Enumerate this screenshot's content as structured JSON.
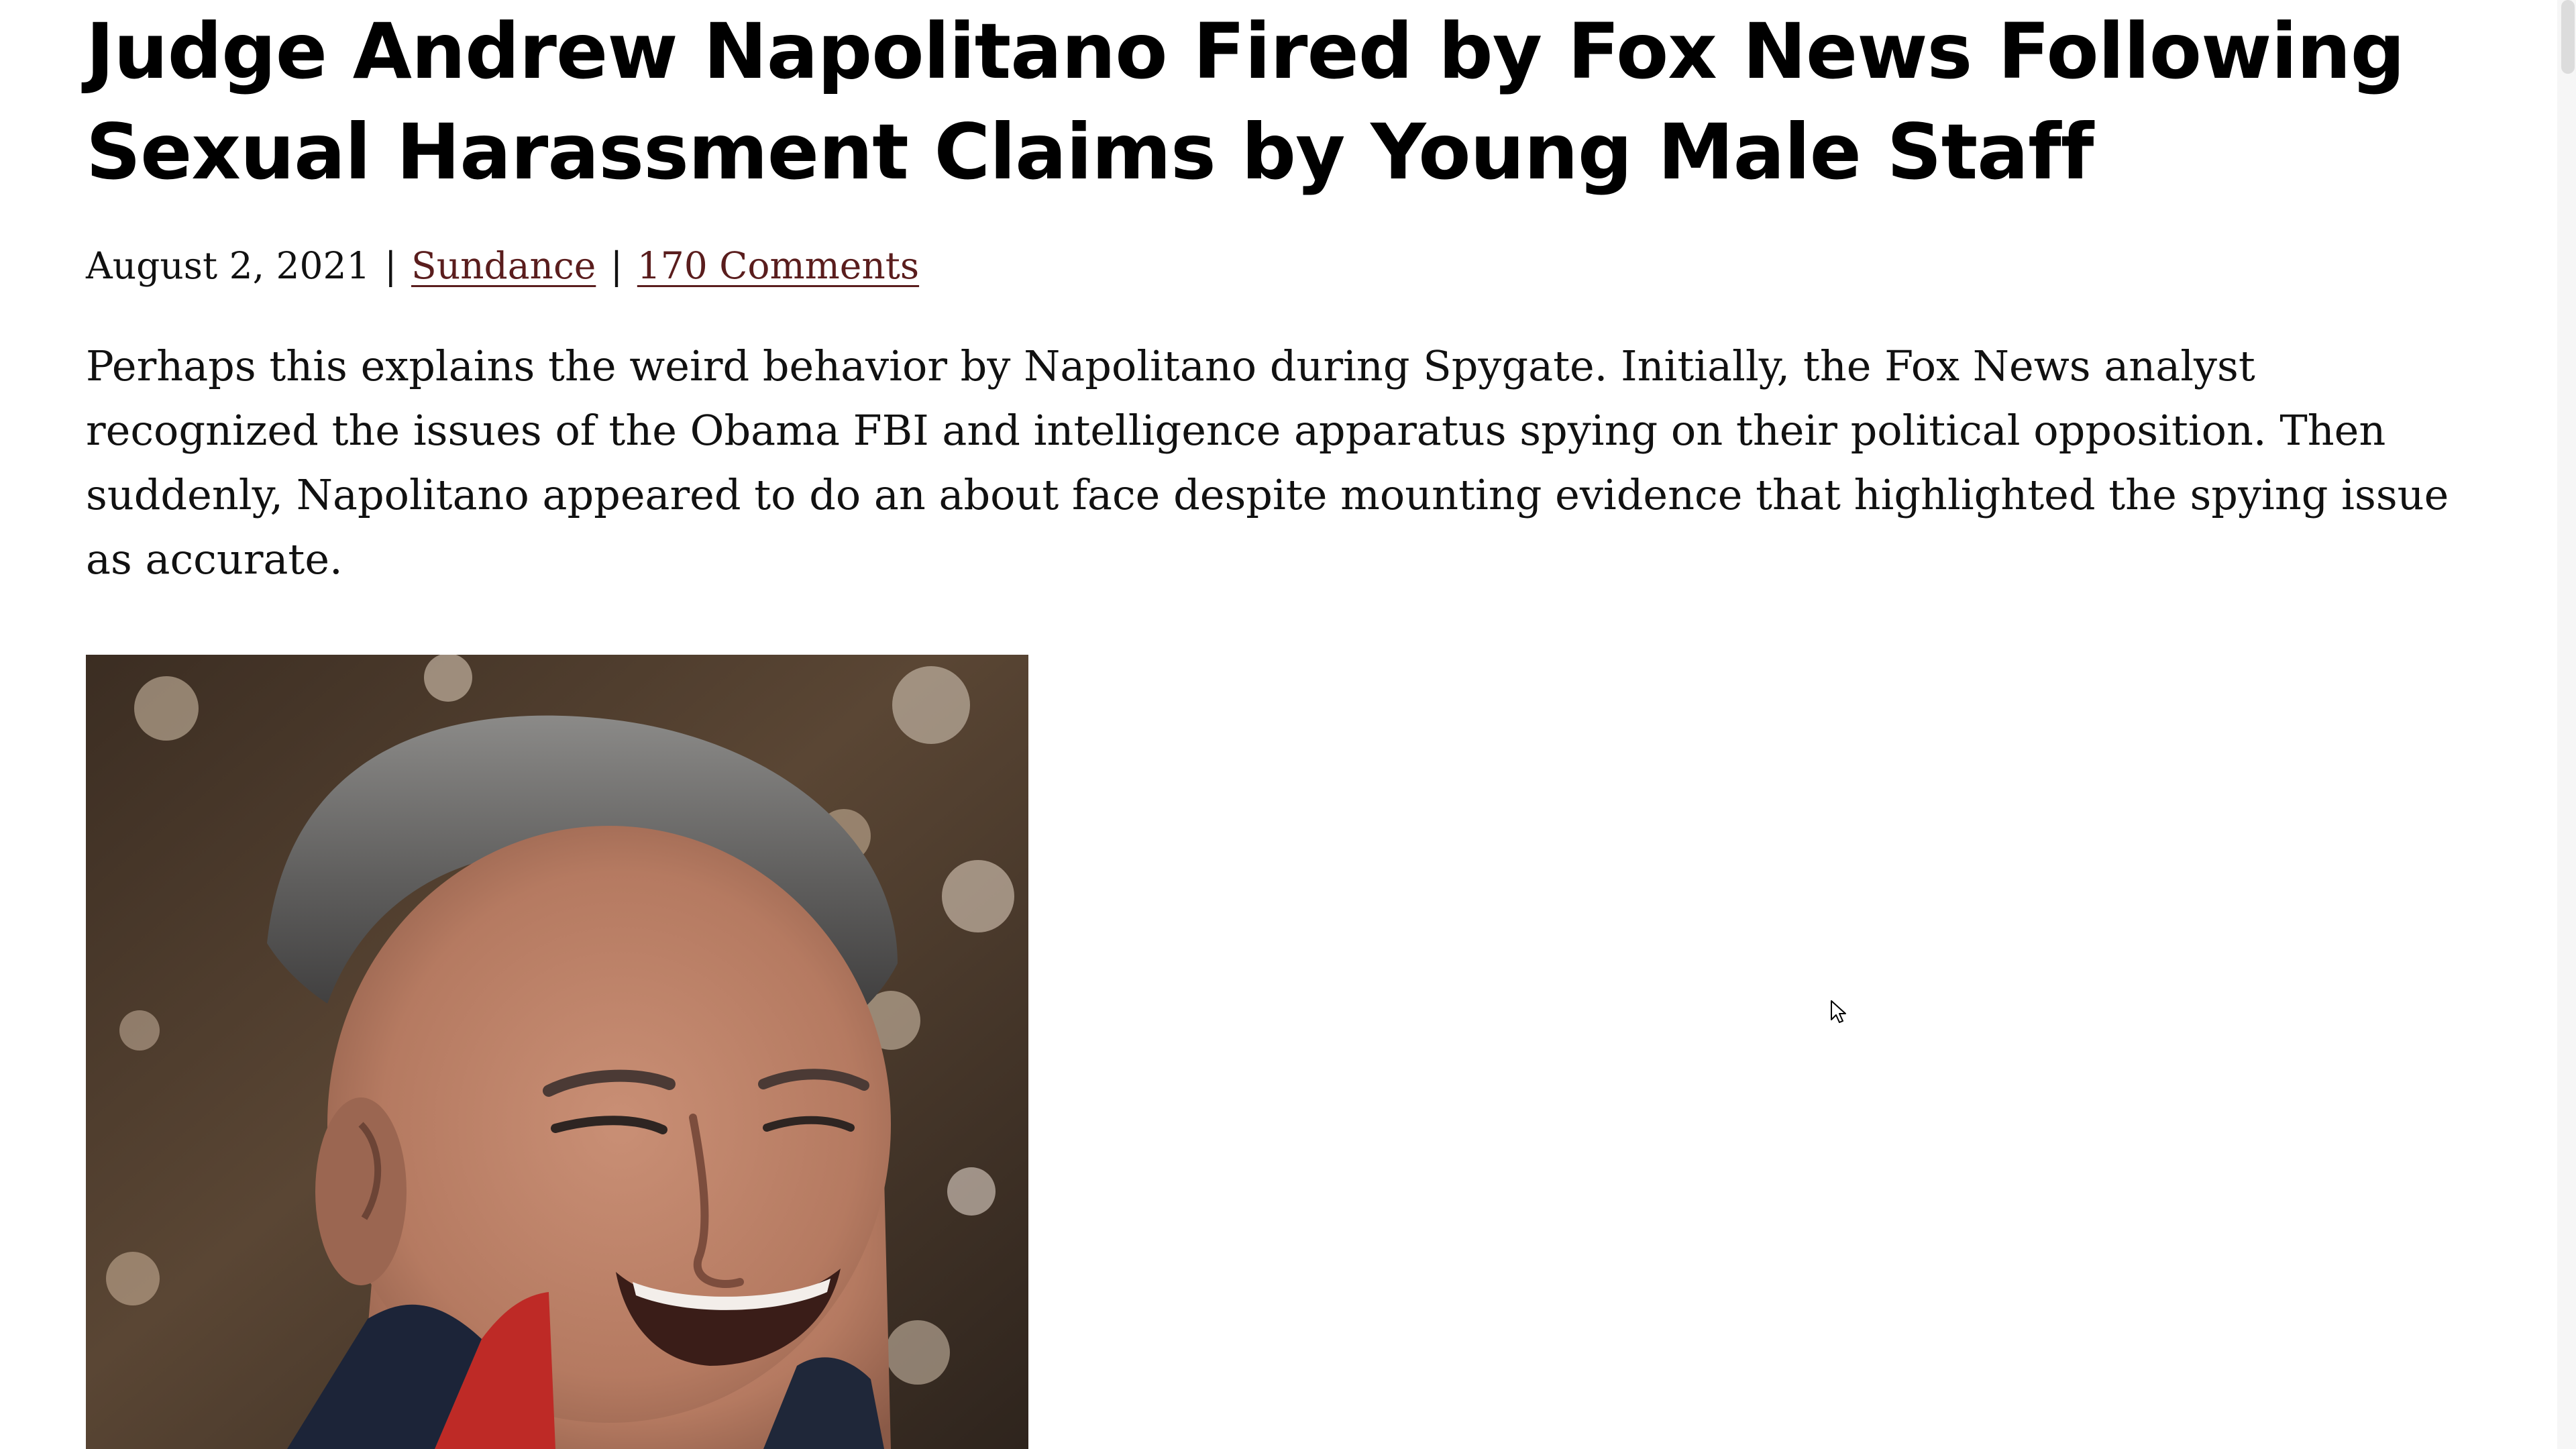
{
  "article": {
    "headline": "Judge Andrew Napolitano Fired by Fox News Following Sexual Harassment Claims by Young Male Staff",
    "date": "August 2, 2021",
    "separator": "|",
    "author": "Sundance",
    "comments": "170 Comments",
    "lede": "Perhaps this explains the weird behavior by Napolitano during Spygate.  Initially, the Fox News analyst recognized the issues of the Obama FBI and intelligence apparatus spying on their political opposition. Then suddenly, Napolitano appeared to do an about face despite mounting evidence that highlighted the spying issue as accurate."
  },
  "colors": {
    "link": "#5a1d1d",
    "text": "#111111",
    "background": "#ffffff"
  },
  "icons": {
    "pointer": "mouse-pointer-icon"
  }
}
